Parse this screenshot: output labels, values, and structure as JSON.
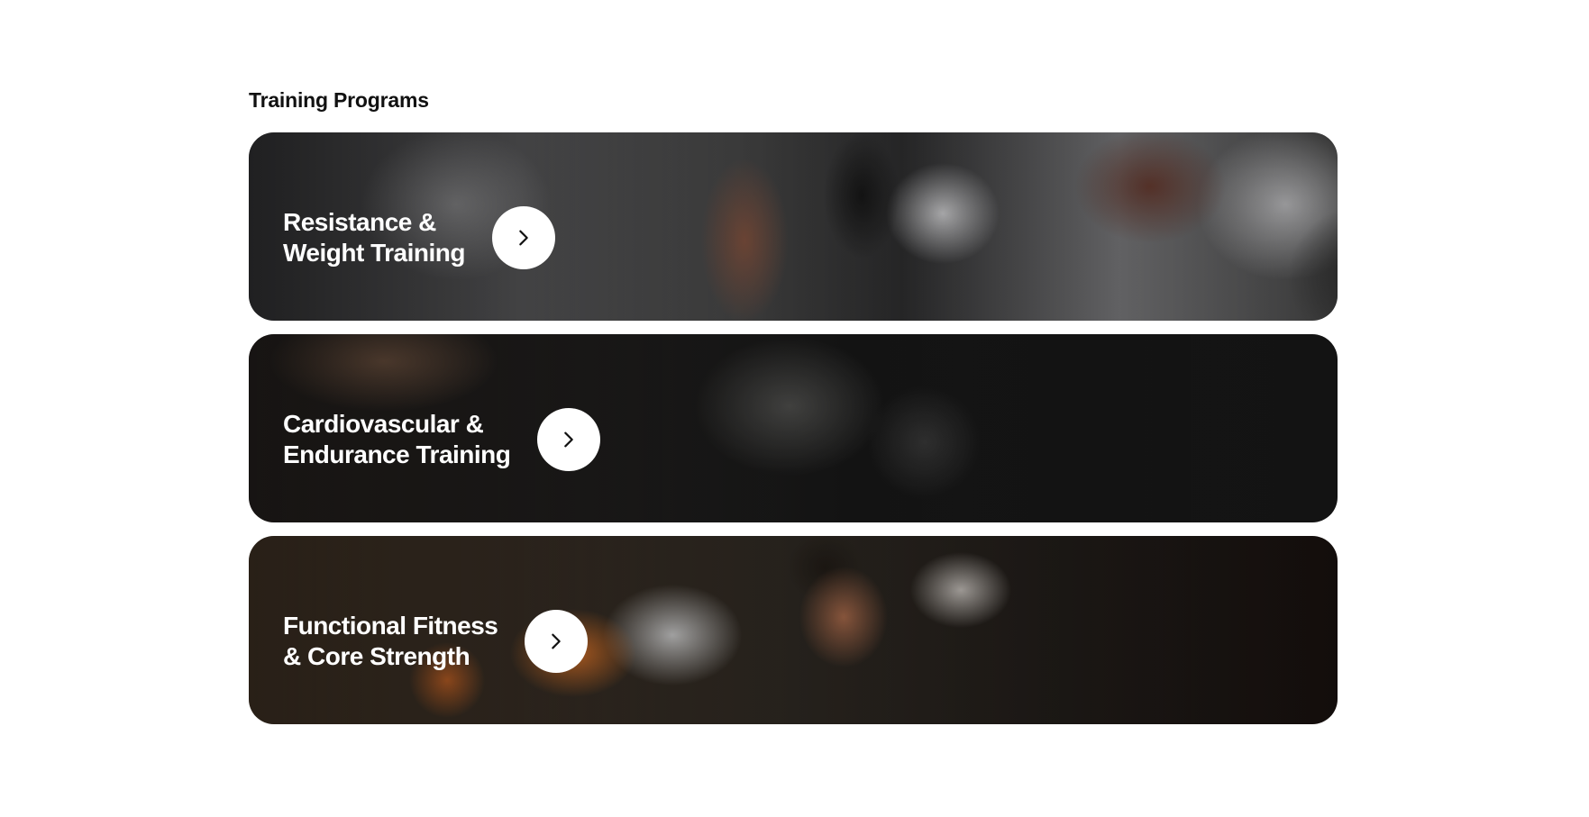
{
  "section": {
    "title": "Training Programs"
  },
  "cards": [
    {
      "title": "Resistance &\nWeight Training",
      "icon": "chevron-right-icon"
    },
    {
      "title": "Cardiovascular &\nEndurance Training",
      "icon": "chevron-right-icon"
    },
    {
      "title": "Functional Fitness\n& Core Strength",
      "icon": "chevron-right-icon"
    }
  ]
}
